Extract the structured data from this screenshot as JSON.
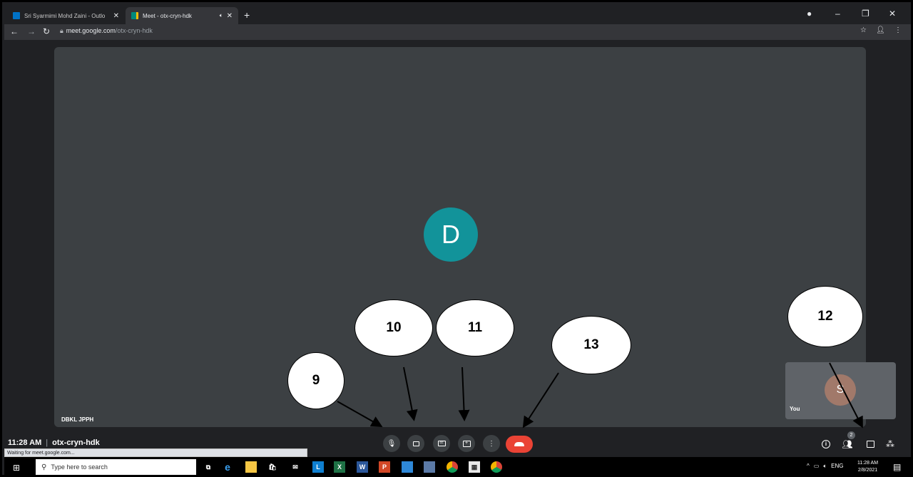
{
  "browser": {
    "tabs": [
      {
        "title": "Sri Syarmimi Mohd Zaini - Outlo",
        "favicon": "outlook-icon",
        "active": false
      },
      {
        "title": "Meet - otx-cryn-hdk",
        "favicon": "meet-icon",
        "active": true
      }
    ],
    "new_tab_label": "+",
    "url_host": "meet.google.com",
    "url_path": "/otx-cryn-hdk",
    "status_text": "Waiting for meet.google.com..."
  },
  "meet": {
    "main_participant_initial": "D",
    "main_participant_name": "DBKL JPPH",
    "self_initial": "S",
    "self_label": "You",
    "time": "11:28 AM",
    "meeting_code": "otx-cryn-hdk",
    "people_count": "2",
    "colors": {
      "avatar_d": "#12939a",
      "avatar_s": "#a1796a",
      "end_call": "#ea4335",
      "tile": "#3c4043",
      "background": "#202124"
    }
  },
  "annotations": [
    {
      "label": "9"
    },
    {
      "label": "10"
    },
    {
      "label": "11"
    },
    {
      "label": "12"
    },
    {
      "label": "13"
    }
  ],
  "taskbar": {
    "search_placeholder": "Type here to search",
    "tray_lang": "ENG",
    "clock_time": "11:28 AM",
    "clock_date": "2/8/2021",
    "notification_count": "2"
  }
}
